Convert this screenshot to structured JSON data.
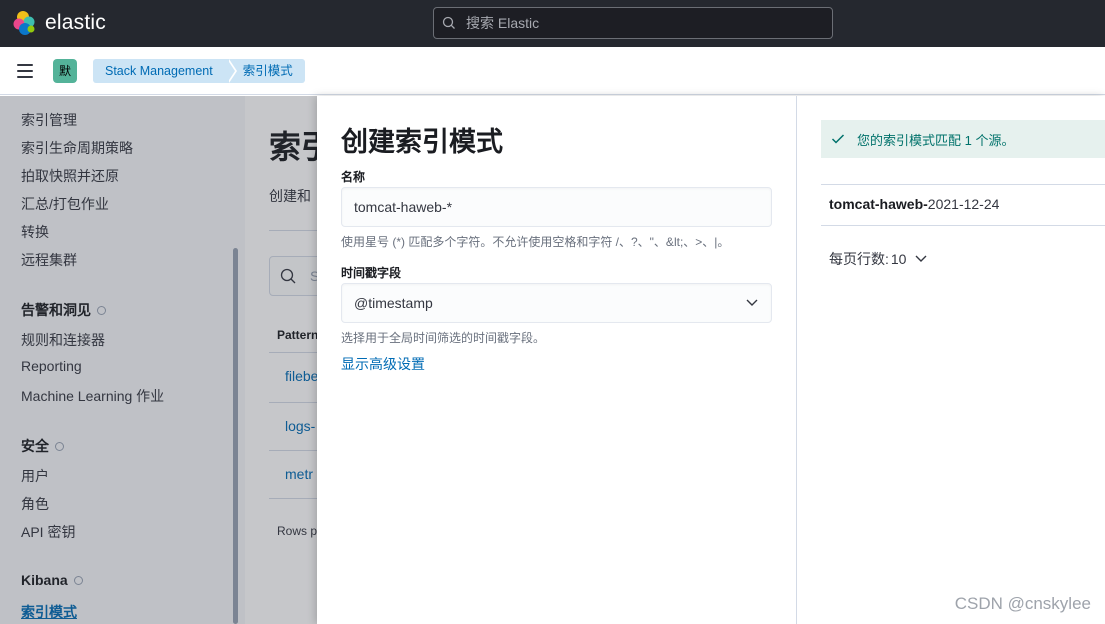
{
  "topbar": {
    "brand": "elastic",
    "search_placeholder": "搜索 Elastic",
    "logo_colors": [
      "#f0bf1a",
      "#3ebeb0",
      "#e9478b",
      "#07c",
      "#00bfb3",
      "#fed10a"
    ]
  },
  "header": {
    "space_initial": "默",
    "breadcrumbs": [
      "Stack Management",
      "索引模式"
    ],
    "accent": "#54b399"
  },
  "sidebar": {
    "items_group1": [
      "索引管理",
      "索引生命周期策略",
      "拍取快照并还原",
      "汇总/打包作业",
      "转换",
      "远程集群"
    ],
    "section_alerts": "告警和洞见",
    "items_alerts": [
      "规则和连接器",
      "Reporting",
      "Machine Learning 作业"
    ],
    "section_security": "安全",
    "items_security": [
      "用户",
      "角色",
      "API 密钥"
    ],
    "section_kibana": "Kibana",
    "active_item": "索引模式"
  },
  "background_page": {
    "title": "索引",
    "subtitle": "创建和",
    "search_stub": "S",
    "table_header": "Pattern",
    "rows": [
      "filebe",
      "logs-",
      "metr"
    ],
    "rows_per_page": "Rows p"
  },
  "flyout": {
    "title": "创建索引模式",
    "name_label": "名称",
    "name_value": "tomcat-haweb-*",
    "name_help": "使用星号 (*) 匹配多个字符。不允许使用空格和字符 /、?、\"、&lt;、>、|。",
    "timestamp_label": "时间戳字段",
    "timestamp_value": "@timestamp",
    "timestamp_help": "选择用于全局时间筛选的时间戳字段。",
    "advanced_link": "显示高级设置",
    "callout_text": "您的索引模式匹配 1 个源。",
    "source_bold": "tomcat-haweb-",
    "source_rest": "2021-12-24",
    "rows_per_page_label": "每页行数:",
    "rows_per_page_value": "10",
    "callout_color": "#00726b"
  },
  "watermark": "CSDN @cnskylee"
}
